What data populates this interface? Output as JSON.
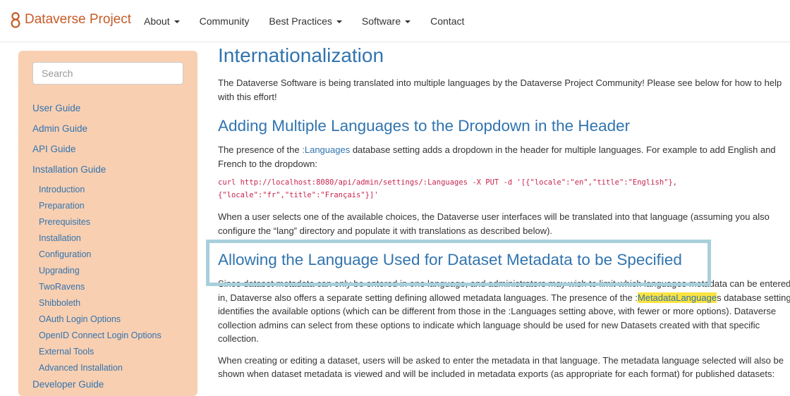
{
  "brand": {
    "name": "Dataverse Project"
  },
  "nav": {
    "items": [
      {
        "label": "About",
        "dropdown": true
      },
      {
        "label": "Community",
        "dropdown": false
      },
      {
        "label": "Best Practices",
        "dropdown": true
      },
      {
        "label": "Software",
        "dropdown": true
      },
      {
        "label": "Contact",
        "dropdown": false
      }
    ]
  },
  "sidebar": {
    "search_placeholder": "Search",
    "top": [
      "User Guide",
      "Admin Guide",
      "API Guide",
      "Installation Guide"
    ],
    "sub": [
      "Introduction",
      "Preparation",
      "Prerequisites",
      "Installation",
      "Configuration",
      "Upgrading",
      "TwoRavens",
      "Shibboleth",
      "OAuth Login Options",
      "OpenID Connect Login Options",
      "External Tools",
      "Advanced Installation"
    ],
    "developer": "Developer Guide"
  },
  "content": {
    "title": "Internationalization",
    "intro": "The Dataverse Software is being translated into multiple languages by the Dataverse Project Community! Please see below for how to help with this effort!",
    "s1": {
      "heading": "Adding Multiple Languages to the Dropdown in the Header",
      "p_before": "The presence of the ",
      "p_link": ":Languages",
      "p_after": " database setting adds a dropdown in the header for multiple languages. For example to add English and French to the dropdown:",
      "code_line1": "curl http://localhost:8080/api/admin/settings/:Languages -X PUT -d '[{\"locale\":\"en\",\"title\":\"English\"},",
      "code_line2": "{\"locale\":\"fr\",\"title\":\"Français\"}]'",
      "p2": "When a user selects one of the available choices, the Dataverse user interfaces will be translated into that language (assuming you also configure the “lang” directory and populate it with translations as described below)."
    },
    "s2": {
      "heading": "Allowing the Language Used for Dataset Metadata to be Specified",
      "p_before": "Since dataset metadata can only be entered in one language, and administrators may wish to limit which languages metadata can be entered in, Dataverse also offers a separate setting defining allowed metadata languages. The presence of the :",
      "p_link": "MetadataLanguage",
      "p_after": "s database setting identifies the available options (which can be different from those in the :Languages setting above, with fewer or more options). Dataverse collection admins can select from these options to indicate which language should be used for new Datasets created with that specific collection.",
      "p2": "When creating or editing a dataset, users will be asked to enter the metadata in that language. The metadata language selected will also be shown when dataset metadata is viewed and will be included in metadata exports (as appropriate for each format) for published datasets:"
    }
  },
  "colors": {
    "brand": "#c55b28",
    "link": "#3174af",
    "sidebar_bg": "#f9cfb1",
    "highlight": "#fbe33f",
    "focus_box": "#a8cfdc"
  }
}
